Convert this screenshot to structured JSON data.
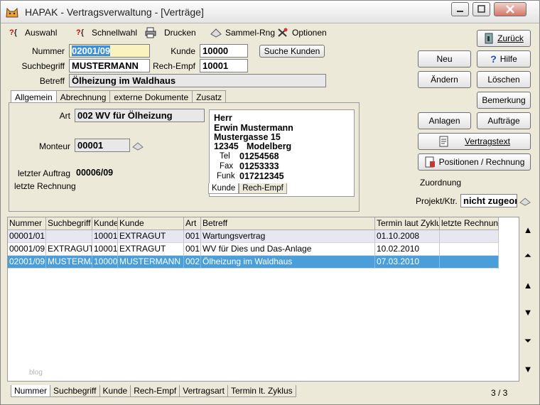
{
  "window": {
    "title": "HAPAK - Vertragsverwaltung - [Verträge]"
  },
  "menu": [
    {
      "icon": "filter-icon",
      "label": "Auswahl"
    },
    {
      "icon": "quick-select-icon",
      "label": "Schnellwahl"
    },
    {
      "icon": "printer-icon",
      "label": "Drucken"
    },
    {
      "icon": "batch-invoice-icon",
      "label": "Sammel-Rng"
    },
    {
      "icon": "options-icon",
      "label": "Optionen"
    }
  ],
  "header": {
    "nummer_label": "Nummer",
    "nummer_value": "02001/09",
    "kunde_label": "Kunde",
    "kunde_value": "10000",
    "suche_kunden": "Suche Kunden",
    "suchbegriff_label": "Suchbegriff",
    "suchbegriff_value": "MUSTERMANN",
    "rech_empf_label": "Rech-Empf",
    "rech_empf_value": "10001",
    "betreff_label": "Betreff",
    "betreff_value": "Ölheizung im Waldhaus"
  },
  "tabs": [
    "Allgemein",
    "Abrechnung",
    "externe Dokumente",
    "Zusatz"
  ],
  "general": {
    "art_label": "Art",
    "art_value": "002 WV für Ölheizung",
    "monteur_label": "Monteur",
    "monteur_value": "00001",
    "letzter_auftrag_label": "letzter Auftrag",
    "letzter_auftrag_value": "00006/09",
    "letzte_rechnung_label": "letzte Rechnung"
  },
  "address": {
    "salutation": "Herr",
    "name": "Erwin Mustermann",
    "street": "Mustergasse 15",
    "zip": "12345",
    "city": "Modelberg",
    "tel_label": "Tel",
    "tel": "01254568",
    "fax_label": "Fax",
    "fax": "01253333",
    "funk_label": "Funk",
    "funk": "017212345",
    "tabs": [
      "Kunde",
      "Rech-Empf"
    ]
  },
  "buttons": {
    "zurueck": "Zurück",
    "neu": "Neu",
    "hilfe": "Hilfe",
    "aendern": "Ändern",
    "loeschen": "Löschen",
    "bemerkung": "Bemerkung",
    "anlagen": "Anlagen",
    "auftraege": "Aufträge",
    "vertragstext": "Vertragstext",
    "positionen": "Positionen / Rechnung"
  },
  "zuordnung": {
    "label": "Zuordnung",
    "projekt_label": "Projekt/Ktr.",
    "projekt_value": "nicht zugeord"
  },
  "grid": {
    "columns": [
      "Nummer",
      "Suchbegriff",
      "Kunde",
      "Kunde",
      "Art",
      "Betreff",
      "Termin laut Zyklus",
      "letzte Rechnung"
    ],
    "rows": [
      [
        "00001/01",
        "",
        "10001",
        "EXTRAGUT",
        "001",
        "Wartungsvertrag",
        "01.10.2008",
        ""
      ],
      [
        "00001/09",
        "EXTRAGUT",
        "10001",
        "EXTRAGUT",
        "001",
        "WV für Dies und Das-Anlage",
        "10.02.2010",
        ""
      ],
      [
        "02001/09",
        "MUSTERMA",
        "10000",
        "MUSTERMANN",
        "002",
        "Ölheizung im Waldhaus",
        "07.03.2010",
        ""
      ]
    ]
  },
  "bottom_tabs": [
    "Nummer",
    "Suchbegriff",
    "Kunde",
    "Rech-Empf",
    "Vertragsart",
    "Termin lt. Zyklus"
  ],
  "record_count": "3 / 3",
  "watermark": "blog",
  "colors": {
    "selection": "#4a9fdb",
    "field_highlight": "#fbf3bf",
    "window_bg": "#ece9d8"
  }
}
